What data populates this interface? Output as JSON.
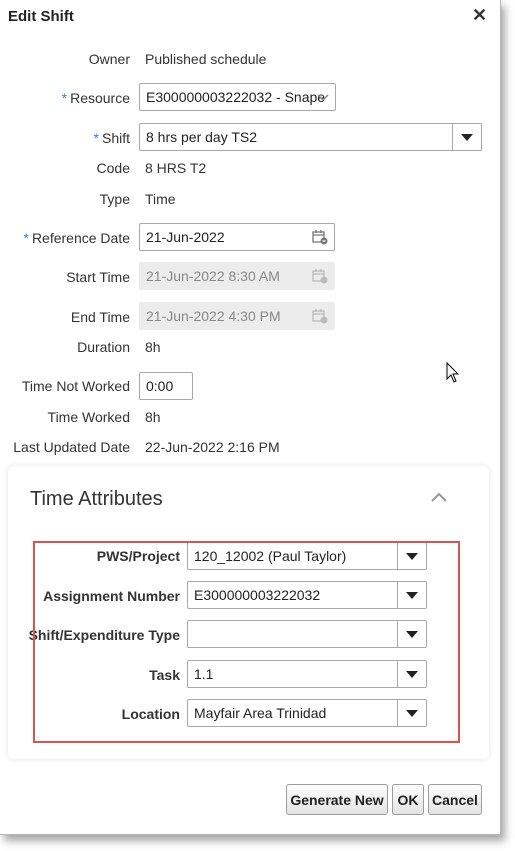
{
  "dialog": {
    "title": "Edit Shift",
    "close_glyph": "✕"
  },
  "form": {
    "owner": {
      "label": "Owner",
      "value": "Published schedule"
    },
    "resource": {
      "label": "Resource",
      "value": "E300000003222032 - Snape"
    },
    "shift": {
      "label": "Shift",
      "value": "8 hrs per day TS2"
    },
    "code": {
      "label": "Code",
      "value": "8 HRS T2"
    },
    "type": {
      "label": "Type",
      "value": "Time"
    },
    "reference_date": {
      "label": "Reference Date",
      "value": "21-Jun-2022"
    },
    "start_time": {
      "label": "Start Time",
      "value": "21-Jun-2022 8:30 AM"
    },
    "end_time": {
      "label": "End Time",
      "value": "21-Jun-2022 4:30 PM"
    },
    "duration": {
      "label": "Duration",
      "value": "8h"
    },
    "time_not_worked": {
      "label": "Time Not Worked",
      "value": "0:00"
    },
    "time_worked": {
      "label": "Time Worked",
      "value": "8h"
    },
    "last_updated": {
      "label": "Last Updated Date",
      "value": "22-Jun-2022 2:16 PM"
    },
    "required_marker": "*"
  },
  "time_attributes": {
    "title": "Time Attributes",
    "pws_project": {
      "label": "PWS/Project",
      "value": "120_12002 (Paul Taylor)"
    },
    "assignment_number": {
      "label": "Assignment Number",
      "value": "E300000003222032"
    },
    "shift_expenditure_type": {
      "label": "Shift/Expenditure Type",
      "value": ""
    },
    "task": {
      "label": "Task",
      "value": "1.1"
    },
    "location": {
      "label": "Location",
      "value": "Mayfair Area Trinidad"
    }
  },
  "buttons": {
    "generate_new": "Generate New",
    "ok": "OK",
    "cancel": "Cancel"
  },
  "colors": {
    "required": "#3a7dbd",
    "highlight_box": "#d9534f"
  }
}
